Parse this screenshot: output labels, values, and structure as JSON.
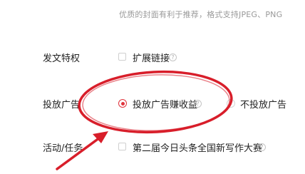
{
  "cover": {
    "hint": "优质的封面有利于推荐，格式支持JPEG、PNG"
  },
  "publish_privilege": {
    "label": "发文特权",
    "option_label": "扩展链接",
    "help_symbol": "?"
  },
  "ad_placement": {
    "label": "投放广告",
    "option_earn_label": "投放广告赚收益",
    "option_none_label": "不投放广告",
    "selected": "投放广告赚收益",
    "help_symbol": "?"
  },
  "activity": {
    "label": "活动/任务",
    "option_label": "第二届今日头条全国新写作大赛",
    "help_symbol": "?"
  },
  "colors": {
    "annotation_red": "#d81e2a",
    "radio_red": "#e0343c"
  }
}
